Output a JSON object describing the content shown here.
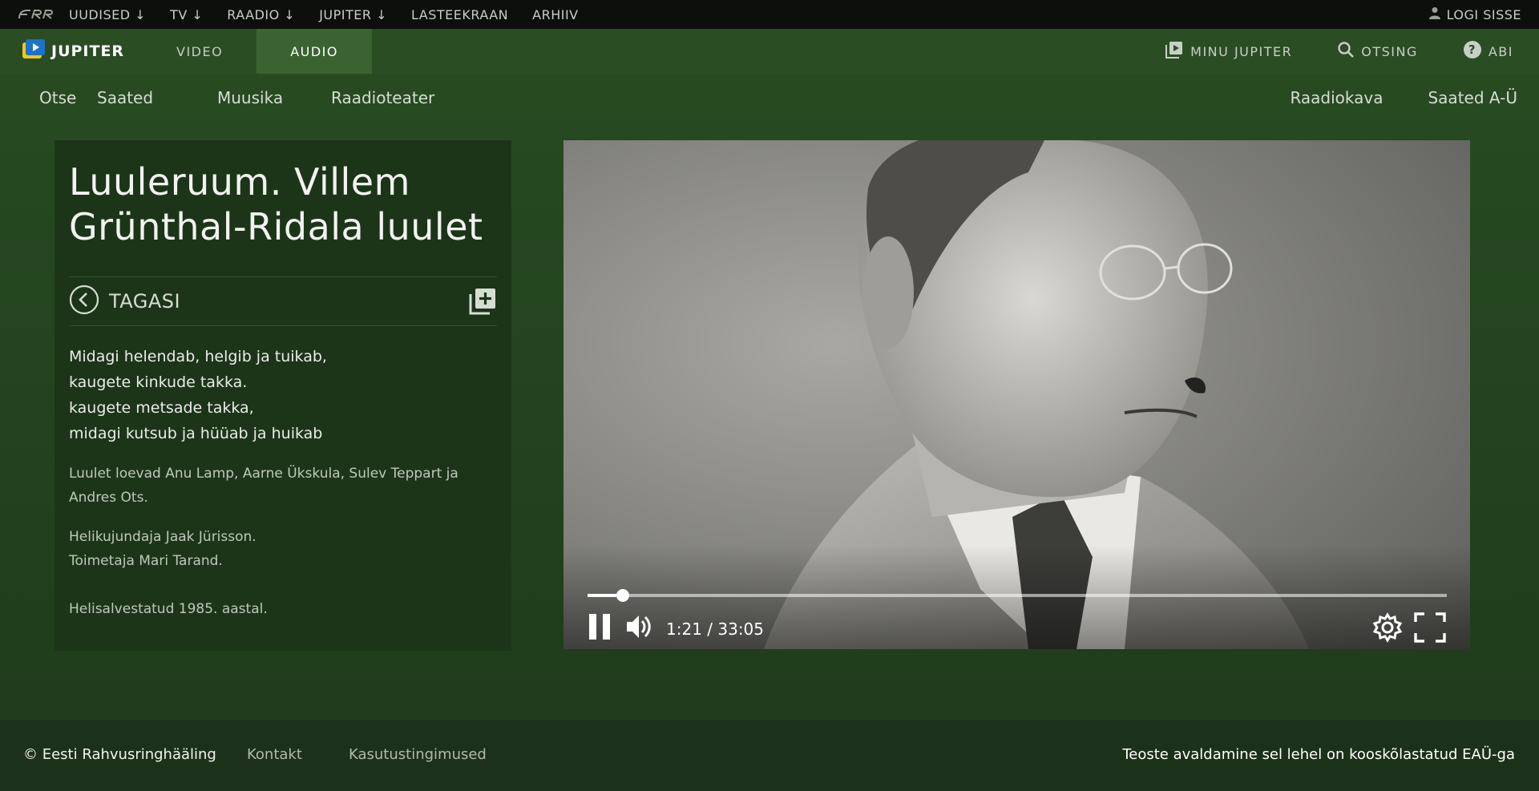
{
  "topbar": {
    "logo": "err-logo",
    "nav": [
      "UUDISED ↓",
      "TV ↓",
      "RAADIO ↓",
      "JUPITER ↓",
      "LASTEEKRAAN",
      "ARHIIV"
    ],
    "login_label": "LOGI SISSE"
  },
  "header": {
    "logo_text": "JUPITER",
    "tabs": [
      {
        "label": "VIDEO",
        "active": false
      },
      {
        "label": "AUDIO",
        "active": true
      }
    ],
    "right": {
      "my_jupiter": "MINU JUPITER",
      "search": "OTSING",
      "help": "ABI"
    }
  },
  "subnav": {
    "left": [
      "Otse",
      "Saated",
      "Muusika",
      "Raadioteater"
    ],
    "right": [
      "Raadiokava",
      "Saated A-Ü"
    ]
  },
  "episode": {
    "title": "Luuleruum. Villem Grünthal-Ridala luulet",
    "back_label": "TAGASI",
    "poem_lines": [
      "Midagi helendab, helgib ja tuikab,",
      "kaugete kinkude takka.",
      "kaugete metsade takka,",
      "midagi kutsub ja hüüab ja huikab"
    ],
    "readers_line1": "Luulet loevad Anu Lamp, Aarne Ükskula, Sulev Teppart ja",
    "readers_line2": "Andres Ots.",
    "credit_sound": "Helikujundaja Jaak Jürisson.",
    "credit_editor": "Toimetaja Mari Tarand.",
    "recorded": "Helisalvestatud 1985. aastal."
  },
  "player": {
    "time_display": "1:21 / 33:05",
    "progress_fraction": 0.041,
    "state": "playing"
  },
  "footer": {
    "copyright": "© Eesti Rahvusringhääling",
    "contact": "Kontakt",
    "terms": "Kasutustingimused",
    "notice": "Teoste avaldamine sel lehel on kooskõlastatud EAÜ-ga"
  },
  "colors": {
    "background": "#284c22",
    "panel": "#1c3519",
    "topbar": "#0c0f0b",
    "active_tab": "#3a6331",
    "logo_yellow": "#f5c518",
    "logo_blue": "#1a73c9"
  }
}
